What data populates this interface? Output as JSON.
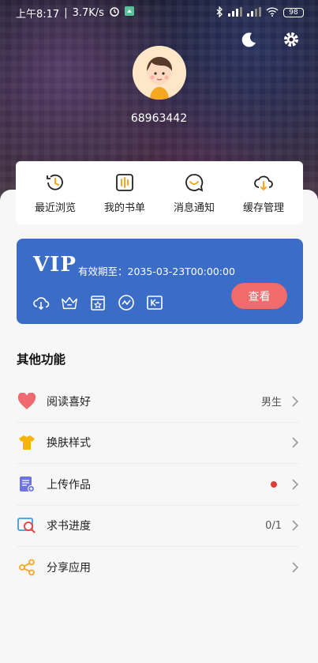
{
  "status": {
    "time": "上午8:17",
    "speed": "3.7K/s",
    "battery": "98"
  },
  "user": {
    "id": "68963442"
  },
  "quick_actions": [
    {
      "label": "最近浏览",
      "icon": "history-icon"
    },
    {
      "label": "我的书单",
      "icon": "booklist-icon"
    },
    {
      "label": "消息通知",
      "icon": "message-icon"
    },
    {
      "label": "缓存管理",
      "icon": "cloud-download-icon"
    }
  ],
  "vip": {
    "title": "VIP",
    "expiry": "有效期至：2035-03-23T00:00:00",
    "button": "查看",
    "color": "#3b6cc6"
  },
  "other": {
    "title": "其他功能",
    "items": [
      {
        "label": "阅读喜好",
        "value": "男生",
        "icon": "heart-icon"
      },
      {
        "label": "换肤样式",
        "value": "",
        "icon": "tshirt-icon"
      },
      {
        "label": "上传作品",
        "value": "",
        "icon": "upload-doc-icon",
        "badge": true
      },
      {
        "label": "求书进度",
        "value": "0/1",
        "icon": "search-progress-icon"
      },
      {
        "label": "分享应用",
        "value": "",
        "icon": "share-icon"
      }
    ]
  }
}
